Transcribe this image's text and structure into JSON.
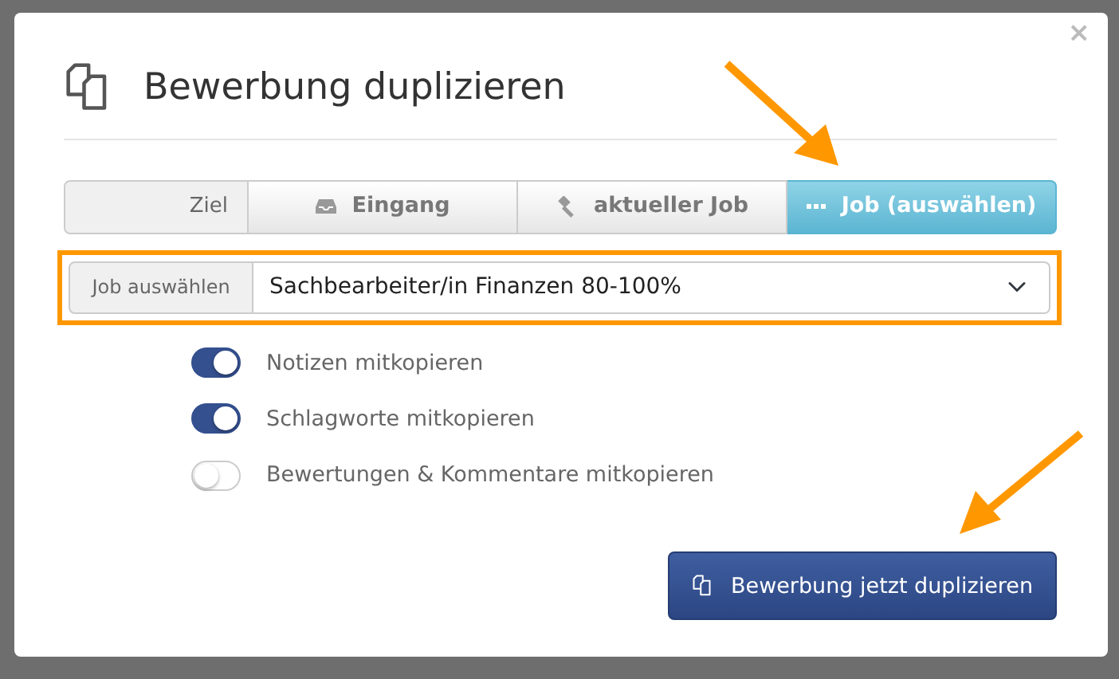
{
  "dialog": {
    "title": "Bewerbung duplizieren",
    "close": "×"
  },
  "target": {
    "label": "Ziel",
    "options": [
      {
        "label": "Eingang",
        "kind": "inbox",
        "selected": false
      },
      {
        "label": "aktueller Job",
        "kind": "current",
        "selected": false
      },
      {
        "label": "Job (auswählen)",
        "kind": "choose",
        "selected": true
      }
    ]
  },
  "job_select": {
    "label": "Job auswählen",
    "value": "Sachbearbeiter/in Finanzen 80-100%",
    "highlighted": true
  },
  "options": [
    {
      "label": "Notizen mitkopieren",
      "on": true
    },
    {
      "label": "Schlagworte mitkopieren",
      "on": true
    },
    {
      "label": "Bewertungen & Kommentare mitkopieren",
      "on": false
    }
  ],
  "submit": {
    "label": "Bewerbung jetzt duplizieren"
  }
}
